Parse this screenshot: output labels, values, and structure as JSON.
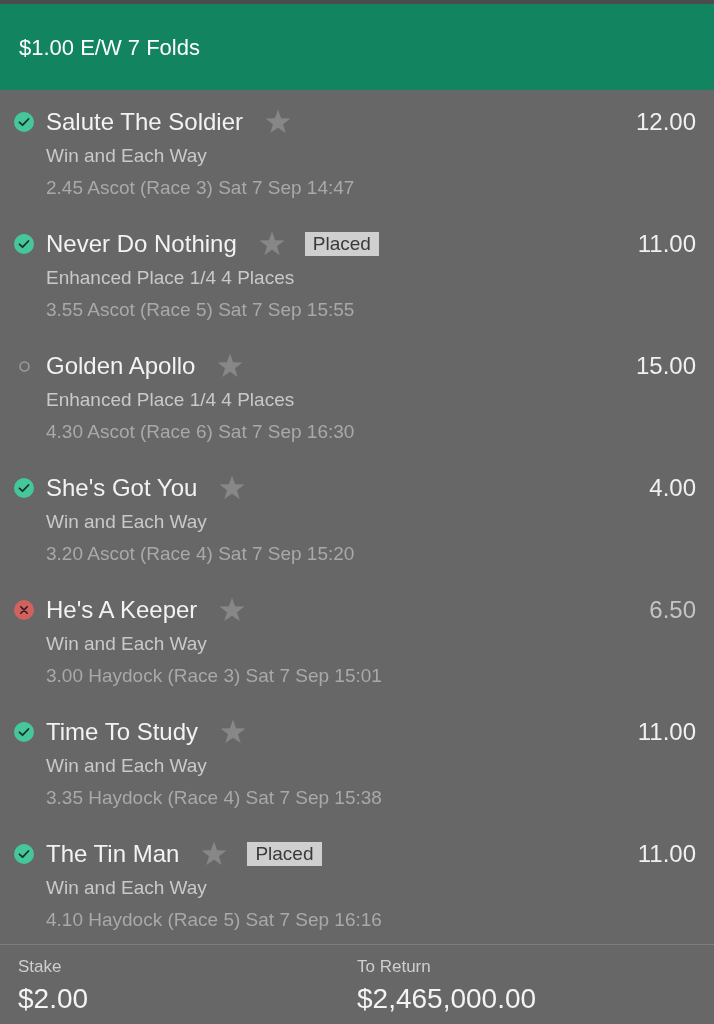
{
  "header": {
    "title": "$1.00 E/W 7 Folds"
  },
  "selections": [
    {
      "name": "Salute The Soldier",
      "kind": "won",
      "market": "Win and Each Way",
      "event": "2.45 Ascot (Race 3) Sat 7 Sep 14:47",
      "odds": "12.00"
    },
    {
      "name": "Never Do Nothing",
      "kind": "won",
      "badge": "Placed",
      "market": "Enhanced Place 1/4 4 Places",
      "event": "3.55 Ascot (Race 5) Sat 7 Sep 15:55",
      "odds": "11.00"
    },
    {
      "name": "Golden Apollo",
      "kind": "pending",
      "market": "Enhanced Place 1/4 4 Places",
      "event": "4.30 Ascot (Race 6) Sat 7 Sep 16:30",
      "odds": "15.00"
    },
    {
      "name": "She's Got You",
      "kind": "won",
      "market": "Win and Each Way",
      "event": "3.20 Ascot (Race 4) Sat 7 Sep 15:20",
      "odds": "4.00"
    },
    {
      "name": "He's A Keeper",
      "kind": "lost",
      "market": "Win and Each Way",
      "event": "3.00 Haydock (Race 3) Sat 7 Sep 15:01",
      "odds": "6.50"
    },
    {
      "name": "Time To Study",
      "kind": "won",
      "market": "Win and Each Way",
      "event": "3.35 Haydock (Race 4) Sat 7 Sep 15:38",
      "odds": "11.00"
    },
    {
      "name": "The Tin Man",
      "kind": "won",
      "badge": "Placed",
      "market": "Win and Each Way",
      "event": "4.10 Haydock (Race 5) Sat 7 Sep 16:16",
      "odds": "11.00"
    }
  ],
  "footer": {
    "stake": {
      "label": "Stake",
      "value": "$2.00"
    },
    "returns": {
      "label": "To Return",
      "value": "$2,465,000.00"
    }
  }
}
